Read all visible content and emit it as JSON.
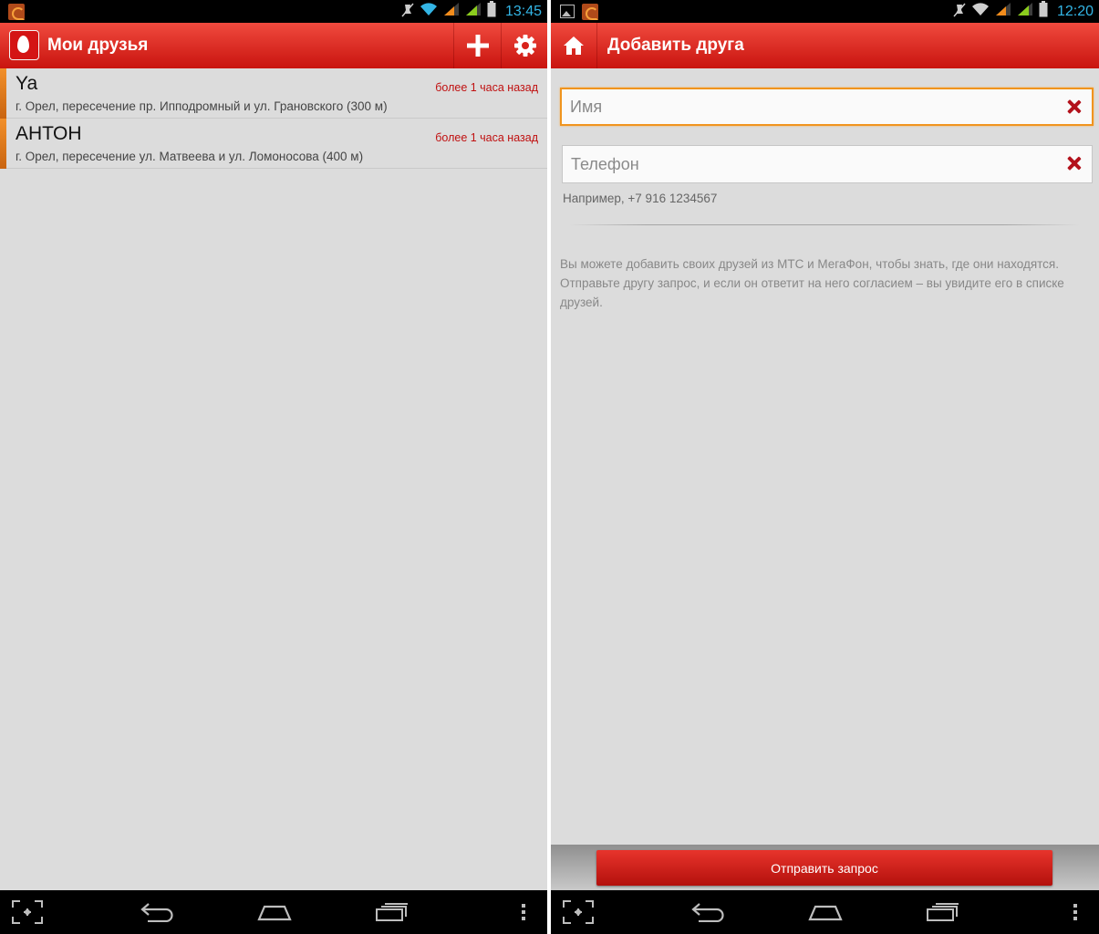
{
  "left": {
    "status": {
      "time": "13:45"
    },
    "actionbar": {
      "title": "Мои друзья",
      "icons": [
        "app-logo-icon",
        "add-icon",
        "settings-gear-icon"
      ]
    },
    "friends": [
      {
        "name": "Ya",
        "address": "г. Орел, пересечение пр. Ипподромный и ул. Грановского (300 м)",
        "time": "более 1 часа назад"
      },
      {
        "name": "АНТОН",
        "address": "г. Орел, пересечение ул. Матвеева и ул. Ломоносова (400 м)",
        "time": "более 1 часа назад"
      }
    ]
  },
  "right": {
    "status": {
      "time": "12:20"
    },
    "actionbar": {
      "title": "Добавить друга",
      "icons": [
        "home-icon"
      ]
    },
    "form": {
      "name_placeholder": "Имя",
      "phone_placeholder": "Телефон",
      "phone_hint": "Например, +7 916 1234567",
      "info": "Вы можете добавить своих друзей из МТС и МегаФон, чтобы знать, где они находятся. Отправьте другу запрос, и если он ответит на него согласием – вы увидите его в списке друзей.",
      "submit_label": "Отправить запрос"
    }
  },
  "navbar": {
    "icons": [
      "screenshot-icon",
      "back-icon",
      "home-icon",
      "recent-apps-icon",
      "menu-icon"
    ]
  },
  "colors": {
    "accent_red": "#d41414",
    "focus_orange": "#f0941e",
    "status_time": "#33b5e5"
  }
}
